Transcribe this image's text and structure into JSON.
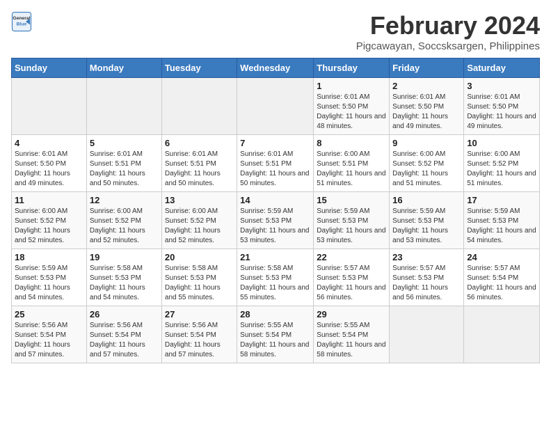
{
  "logo": {
    "line1": "General",
    "line2": "Blue"
  },
  "title": "February 2024",
  "subtitle": "Pigcawayan, Soccsksargen, Philippines",
  "days_of_week": [
    "Sunday",
    "Monday",
    "Tuesday",
    "Wednesday",
    "Thursday",
    "Friday",
    "Saturday"
  ],
  "weeks": [
    [
      {
        "day": "",
        "info": ""
      },
      {
        "day": "",
        "info": ""
      },
      {
        "day": "",
        "info": ""
      },
      {
        "day": "",
        "info": ""
      },
      {
        "day": "1",
        "info": "Sunrise: 6:01 AM\nSunset: 5:50 PM\nDaylight: 11 hours and 48 minutes."
      },
      {
        "day": "2",
        "info": "Sunrise: 6:01 AM\nSunset: 5:50 PM\nDaylight: 11 hours and 49 minutes."
      },
      {
        "day": "3",
        "info": "Sunrise: 6:01 AM\nSunset: 5:50 PM\nDaylight: 11 hours and 49 minutes."
      }
    ],
    [
      {
        "day": "4",
        "info": "Sunrise: 6:01 AM\nSunset: 5:50 PM\nDaylight: 11 hours and 49 minutes."
      },
      {
        "day": "5",
        "info": "Sunrise: 6:01 AM\nSunset: 5:51 PM\nDaylight: 11 hours and 50 minutes."
      },
      {
        "day": "6",
        "info": "Sunrise: 6:01 AM\nSunset: 5:51 PM\nDaylight: 11 hours and 50 minutes."
      },
      {
        "day": "7",
        "info": "Sunrise: 6:01 AM\nSunset: 5:51 PM\nDaylight: 11 hours and 50 minutes."
      },
      {
        "day": "8",
        "info": "Sunrise: 6:00 AM\nSunset: 5:51 PM\nDaylight: 11 hours and 51 minutes."
      },
      {
        "day": "9",
        "info": "Sunrise: 6:00 AM\nSunset: 5:52 PM\nDaylight: 11 hours and 51 minutes."
      },
      {
        "day": "10",
        "info": "Sunrise: 6:00 AM\nSunset: 5:52 PM\nDaylight: 11 hours and 51 minutes."
      }
    ],
    [
      {
        "day": "11",
        "info": "Sunrise: 6:00 AM\nSunset: 5:52 PM\nDaylight: 11 hours and 52 minutes."
      },
      {
        "day": "12",
        "info": "Sunrise: 6:00 AM\nSunset: 5:52 PM\nDaylight: 11 hours and 52 minutes."
      },
      {
        "day": "13",
        "info": "Sunrise: 6:00 AM\nSunset: 5:52 PM\nDaylight: 11 hours and 52 minutes."
      },
      {
        "day": "14",
        "info": "Sunrise: 5:59 AM\nSunset: 5:53 PM\nDaylight: 11 hours and 53 minutes."
      },
      {
        "day": "15",
        "info": "Sunrise: 5:59 AM\nSunset: 5:53 PM\nDaylight: 11 hours and 53 minutes."
      },
      {
        "day": "16",
        "info": "Sunrise: 5:59 AM\nSunset: 5:53 PM\nDaylight: 11 hours and 53 minutes."
      },
      {
        "day": "17",
        "info": "Sunrise: 5:59 AM\nSunset: 5:53 PM\nDaylight: 11 hours and 54 minutes."
      }
    ],
    [
      {
        "day": "18",
        "info": "Sunrise: 5:59 AM\nSunset: 5:53 PM\nDaylight: 11 hours and 54 minutes."
      },
      {
        "day": "19",
        "info": "Sunrise: 5:58 AM\nSunset: 5:53 PM\nDaylight: 11 hours and 54 minutes."
      },
      {
        "day": "20",
        "info": "Sunrise: 5:58 AM\nSunset: 5:53 PM\nDaylight: 11 hours and 55 minutes."
      },
      {
        "day": "21",
        "info": "Sunrise: 5:58 AM\nSunset: 5:53 PM\nDaylight: 11 hours and 55 minutes."
      },
      {
        "day": "22",
        "info": "Sunrise: 5:57 AM\nSunset: 5:53 PM\nDaylight: 11 hours and 56 minutes."
      },
      {
        "day": "23",
        "info": "Sunrise: 5:57 AM\nSunset: 5:53 PM\nDaylight: 11 hours and 56 minutes."
      },
      {
        "day": "24",
        "info": "Sunrise: 5:57 AM\nSunset: 5:54 PM\nDaylight: 11 hours and 56 minutes."
      }
    ],
    [
      {
        "day": "25",
        "info": "Sunrise: 5:56 AM\nSunset: 5:54 PM\nDaylight: 11 hours and 57 minutes."
      },
      {
        "day": "26",
        "info": "Sunrise: 5:56 AM\nSunset: 5:54 PM\nDaylight: 11 hours and 57 minutes."
      },
      {
        "day": "27",
        "info": "Sunrise: 5:56 AM\nSunset: 5:54 PM\nDaylight: 11 hours and 57 minutes."
      },
      {
        "day": "28",
        "info": "Sunrise: 5:55 AM\nSunset: 5:54 PM\nDaylight: 11 hours and 58 minutes."
      },
      {
        "day": "29",
        "info": "Sunrise: 5:55 AM\nSunset: 5:54 PM\nDaylight: 11 hours and 58 minutes."
      },
      {
        "day": "",
        "info": ""
      },
      {
        "day": "",
        "info": ""
      }
    ]
  ]
}
